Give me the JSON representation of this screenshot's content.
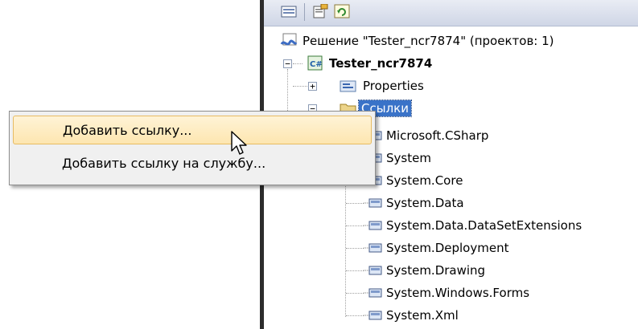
{
  "solution_explorer": {
    "toolbar": {
      "buttons": [
        {
          "icon": "show-all-files-icon"
        },
        {
          "icon": "properties-icon"
        },
        {
          "icon": "refresh-icon"
        }
      ]
    },
    "solution_label": "Решение \"Tester_ncr7874\" (проектов: 1)",
    "project": {
      "label": "Tester_ncr7874",
      "expander": "−"
    },
    "properties": {
      "label": "Properties",
      "expander": "+"
    },
    "references": {
      "label": "Ссылки",
      "expander": "−",
      "items": [
        "Microsoft.CSharp",
        "System",
        "System.Core",
        "System.Data",
        "System.Data.DataSetExtensions",
        "System.Deployment",
        "System.Drawing",
        "System.Windows.Forms",
        "System.Xml"
      ]
    }
  },
  "context_menu": {
    "items": [
      {
        "label": "Добавить ссылку...",
        "highlighted": true
      },
      {
        "label": "Добавить ссылку на службу...",
        "highlighted": false
      }
    ]
  },
  "colors": {
    "selection": "#3a73c8",
    "menu_highlight": "#fde6b0",
    "divider": "#2c2c2c"
  }
}
